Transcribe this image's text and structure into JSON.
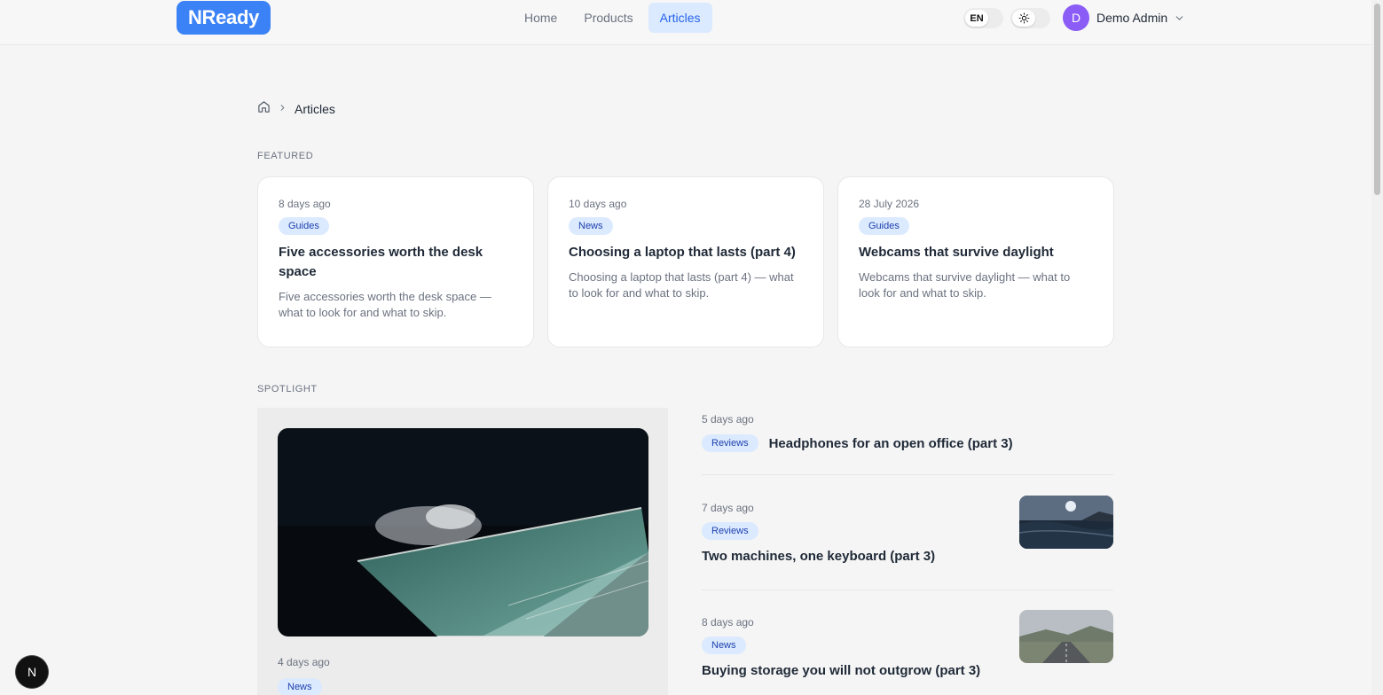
{
  "header": {
    "logo": "NReady",
    "nav": [
      {
        "label": "Home",
        "active": false
      },
      {
        "label": "Products",
        "active": false
      },
      {
        "label": "Articles",
        "active": true
      }
    ],
    "language": "EN",
    "theme_icon": "sun-icon",
    "user": {
      "initial": "D",
      "name": "Demo Admin",
      "avatar_color": "#8b5cf6"
    }
  },
  "breadcrumb": {
    "home_icon": "home-icon",
    "separator_icon": "chevron-right-icon",
    "current": "Articles"
  },
  "featured": {
    "label": "FEATURED",
    "cards": [
      {
        "date": "8 days ago",
        "category": "Guides",
        "title": "Five accessories worth the desk space",
        "excerpt": "Five accessories worth the desk space — what to look for and what to skip."
      },
      {
        "date": "10 days ago",
        "category": "News",
        "title": "Choosing a laptop that lasts (part 4)",
        "excerpt": "Choosing a laptop that lasts (part 4) — what to look for and what to skip."
      },
      {
        "date": "28 July 2026",
        "category": "Guides",
        "title": "Webcams that survive daylight",
        "excerpt": "Webcams that survive daylight — what to look for and what to skip."
      }
    ]
  },
  "spotlight": {
    "label": "SPOTLIGHT",
    "main": {
      "date": "4 days ago",
      "category": "News"
    },
    "items": [
      {
        "date": "5 days ago",
        "category": "Reviews",
        "title": "Headphones for an open office (part 3)"
      },
      {
        "date": "7 days ago",
        "category": "Reviews",
        "title": "Two machines, one keyboard (part 3)"
      },
      {
        "date": "8 days ago",
        "category": "News",
        "title": "Buying storage you will not outgrow (part 3)"
      }
    ]
  },
  "dev_badge": "N",
  "colors": {
    "accent": "#3b82f6",
    "badge_bg": "#dbeafe",
    "badge_text": "#1e40af"
  }
}
